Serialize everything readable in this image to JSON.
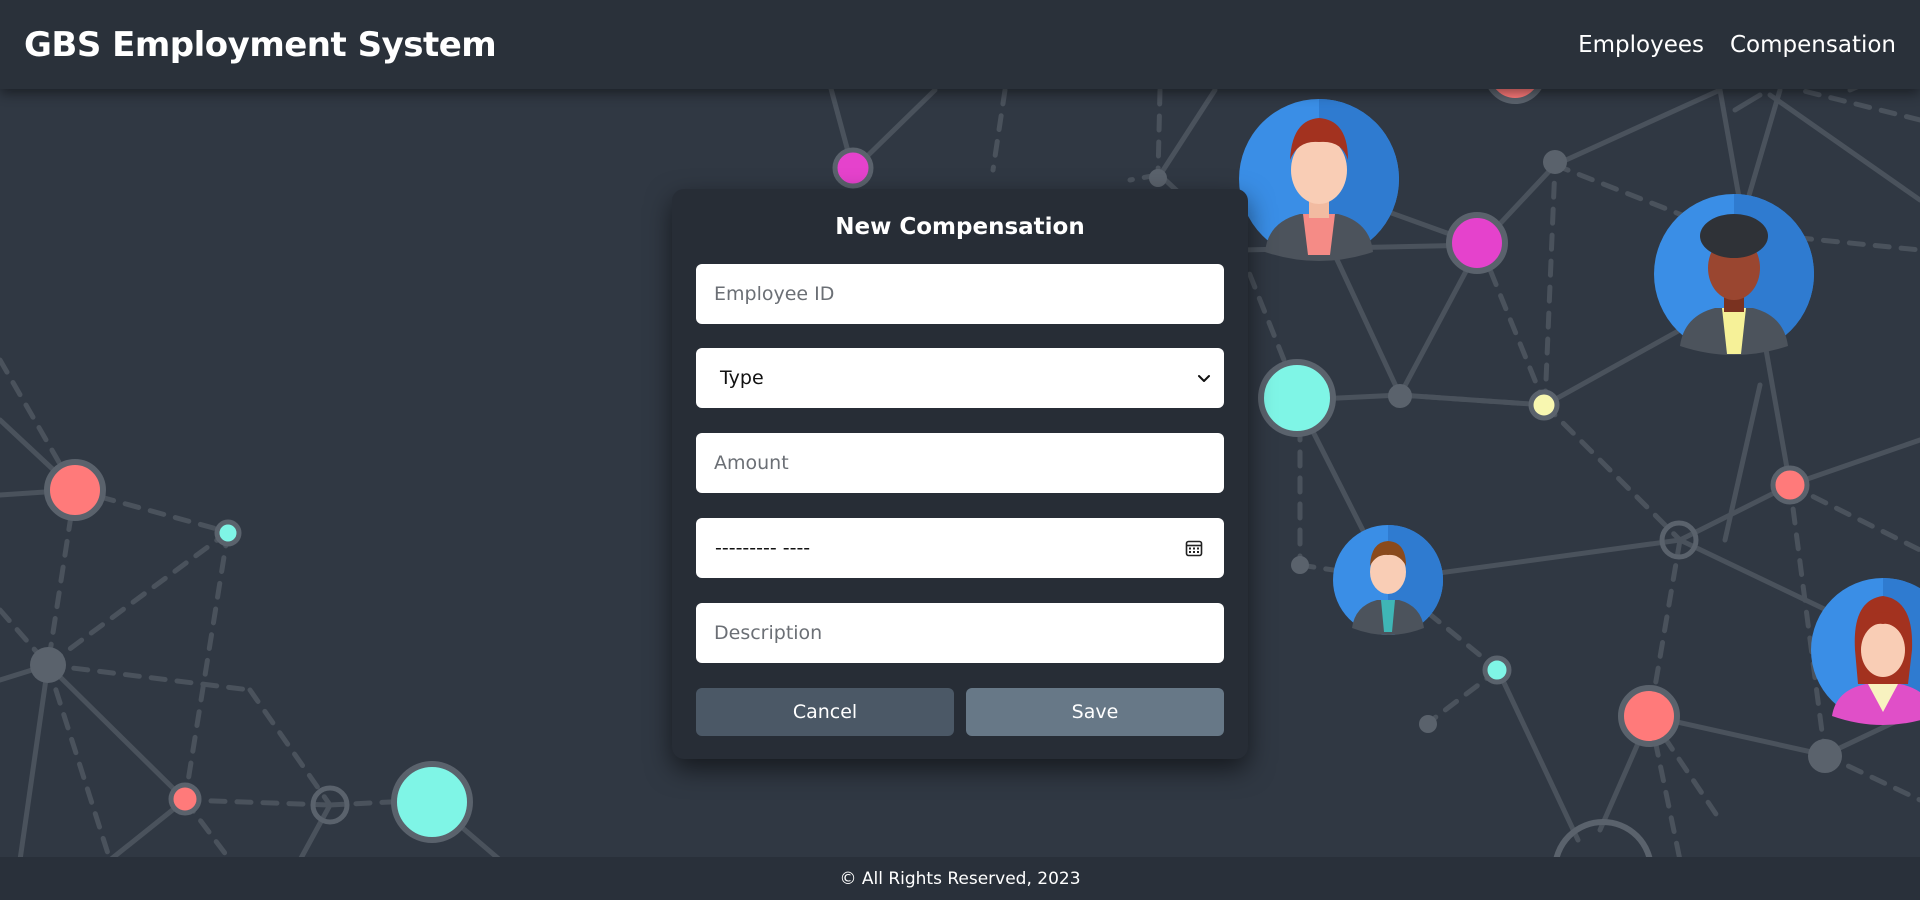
{
  "header": {
    "brand": "GBS Employment System",
    "nav": [
      {
        "label": "Employees"
      },
      {
        "label": "Compensation"
      }
    ]
  },
  "form": {
    "title": "New Compensation",
    "employee_id_placeholder": "Employee ID",
    "type_selected": "Type",
    "amount_placeholder": "Amount",
    "date_value": "--------- ----",
    "description_placeholder": "Description",
    "cancel_label": "Cancel",
    "save_label": "Save"
  },
  "footer": {
    "text": "© All Rights Reserved, 2023"
  },
  "colors": {
    "header_bg": "#2a313a",
    "page_bg": "#303843",
    "card_bg": "#272d36",
    "cancel_bg": "#4b5866",
    "save_bg": "#677887",
    "node_pink": "#e542cc",
    "node_teal": "#7ff5e6",
    "node_coral": "#ff7a7a",
    "node_yellow": "#f8f7b0",
    "avatar_blue": "#3a8ee6"
  },
  "icons": {
    "type_dropdown": "chevron-down-icon",
    "date_picker": "calendar-icon",
    "avatars": [
      "avatar-man-redhair",
      "avatar-man-afro",
      "avatar-man-tie",
      "avatar-woman"
    ]
  }
}
